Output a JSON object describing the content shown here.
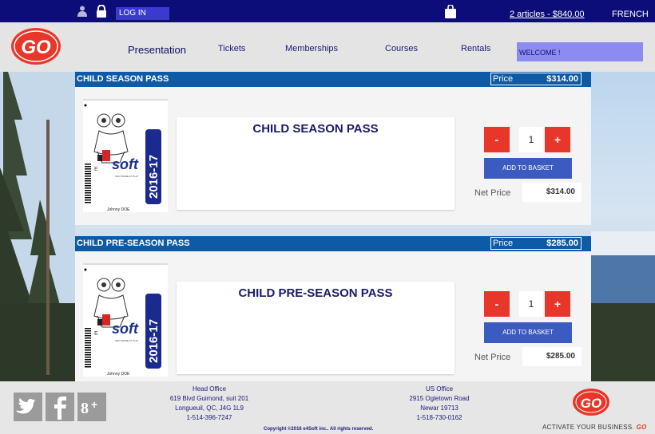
{
  "topbar": {
    "login_label": "LOG IN",
    "cart_label": "2 articles - $840.00",
    "lang_label": "FRENCH"
  },
  "nav": {
    "logo_text": "GO",
    "items": [
      "Presentation",
      "Tickets",
      "Memberships",
      "Courses",
      "Rentals"
    ],
    "welcome": "WELCOME !"
  },
  "products": [
    {
      "title": "CHILD SEASON PASS",
      "price_label": "Price",
      "price": "$314.00",
      "card_year": "2016-17",
      "card_brand": "soft",
      "card_brand_prefix": "E",
      "card_tagline": "SOFTWARE AT PLAY",
      "card_name": "Johnny  DOE",
      "description_title": "CHILD SEASON PASS",
      "qty_minus": "-",
      "qty": "1",
      "qty_plus": "+",
      "add_label": "ADD TO BASKET",
      "net_label": "Net Price",
      "net_value": "$314.00"
    },
    {
      "title": "CHILD PRE-SEASON PASS",
      "price_label": "Price",
      "price": "$285.00",
      "card_year": "2016-17",
      "card_brand": "soft",
      "card_brand_prefix": "E",
      "card_tagline": "SOFTWARE AT PLAY",
      "card_name": "Johnny  DOE",
      "description_title": "CHILD PRE-SEASON PASS",
      "qty_minus": "-",
      "qty": "1",
      "qty_plus": "+",
      "add_label": "ADD TO BASKET",
      "net_label": "Net Price",
      "net_value": "$285.00"
    }
  ],
  "footer": {
    "social": [
      "twitter-icon",
      "facebook-icon",
      "google-plus-icon"
    ],
    "head_office": [
      "Head Office",
      "619 Blvd Guimond, suit 201",
      "Longueuil, QC, J4G 1L9",
      "1-514-396-7247"
    ],
    "us_office": [
      "US Office",
      "2915 Ogletown Road",
      "Newar 19713",
      "1-518-730-0162"
    ],
    "copyright": "Copyright ©2016 e4Soft inc.. All rights reserved.",
    "logo_text": "GO",
    "tagline": "ACTIVATE YOUR BUSINESS.",
    "tagline_brand": "GO"
  },
  "colors": {
    "topbar": "#0d0d7a",
    "accent_red": "#e8372a",
    "panel_header": "#0d5aa6",
    "add_button": "#3c5bc0"
  }
}
